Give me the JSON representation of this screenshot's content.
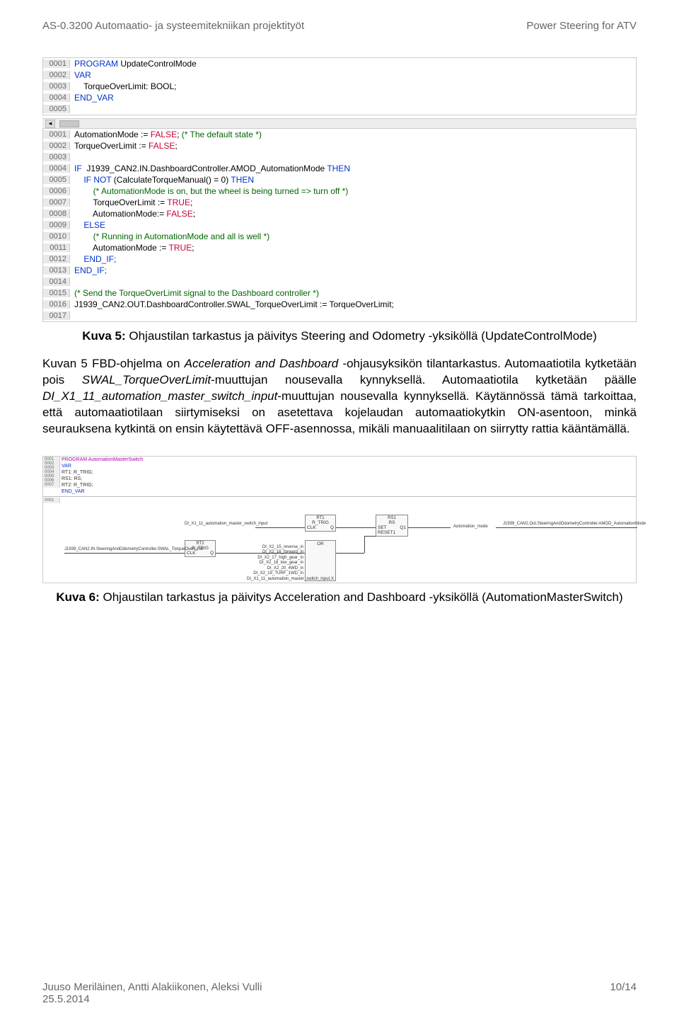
{
  "header": {
    "left": "AS-0.3200 Automaatio- ja systeemitekniikan projektityöt",
    "right": "Power Steering for ATV"
  },
  "code1": {
    "lines": [
      {
        "num": "0001",
        "pre": "",
        "tokens": [
          {
            "t": "PROGRAM ",
            "c": "blue"
          },
          {
            "t": "UpdateControlMode",
            "c": ""
          }
        ]
      },
      {
        "num": "0002",
        "pre": "",
        "tokens": [
          {
            "t": "VAR",
            "c": "blue"
          }
        ]
      },
      {
        "num": "0003",
        "pre": "    ",
        "tokens": [
          {
            "t": "TorqueOverLimit: BOOL;",
            "c": ""
          }
        ]
      },
      {
        "num": "0004",
        "pre": "",
        "tokens": [
          {
            "t": "END_VAR",
            "c": "blue"
          }
        ]
      },
      {
        "num": "0005",
        "pre": "",
        "tokens": []
      }
    ]
  },
  "code2": {
    "lines": [
      {
        "num": "0001",
        "pre": "",
        "tokens": [
          {
            "t": "AutomationMode := ",
            "c": ""
          },
          {
            "t": "FALSE",
            "c": "red"
          },
          {
            "t": "; ",
            "c": ""
          },
          {
            "t": "(* The default state *)",
            "c": "cmnt"
          }
        ]
      },
      {
        "num": "0002",
        "pre": "",
        "tokens": [
          {
            "t": "TorqueOverLimit := ",
            "c": ""
          },
          {
            "t": "FALSE",
            "c": "red"
          },
          {
            "t": ";",
            "c": ""
          }
        ]
      },
      {
        "num": "0003",
        "pre": "",
        "tokens": []
      },
      {
        "num": "0004",
        "pre": "",
        "tokens": [
          {
            "t": "IF  ",
            "c": "blue"
          },
          {
            "t": "J1939_CAN2.IN.DashboardController.AMOD_AutomationMode ",
            "c": ""
          },
          {
            "t": "THEN",
            "c": "blue"
          }
        ]
      },
      {
        "num": "0005",
        "pre": "    ",
        "tokens": [
          {
            "t": "IF NOT ",
            "c": "blue"
          },
          {
            "t": "(CalculateTorqueManual() = 0) ",
            "c": ""
          },
          {
            "t": "THEN",
            "c": "blue"
          }
        ]
      },
      {
        "num": "0006",
        "pre": "        ",
        "tokens": [
          {
            "t": "(* AutomationMode is on, but the wheel is being turned => turn off *)",
            "c": "cmnt"
          }
        ]
      },
      {
        "num": "0007",
        "pre": "        ",
        "tokens": [
          {
            "t": "TorqueOverLimit := ",
            "c": ""
          },
          {
            "t": "TRUE",
            "c": "red"
          },
          {
            "t": ";",
            "c": ""
          }
        ]
      },
      {
        "num": "0008",
        "pre": "        ",
        "tokens": [
          {
            "t": "AutomationMode:= ",
            "c": ""
          },
          {
            "t": "FALSE",
            "c": "red"
          },
          {
            "t": ";",
            "c": ""
          }
        ]
      },
      {
        "num": "0009",
        "pre": "    ",
        "tokens": [
          {
            "t": "ELSE",
            "c": "blue"
          }
        ]
      },
      {
        "num": "0010",
        "pre": "        ",
        "tokens": [
          {
            "t": "(* Running in AutomationMode and all is well *)",
            "c": "cmnt"
          }
        ]
      },
      {
        "num": "0011",
        "pre": "        ",
        "tokens": [
          {
            "t": "AutomationMode := ",
            "c": ""
          },
          {
            "t": "TRUE",
            "c": "red"
          },
          {
            "t": ";",
            "c": ""
          }
        ]
      },
      {
        "num": "0012",
        "pre": "    ",
        "tokens": [
          {
            "t": "END_IF;",
            "c": "blue"
          }
        ]
      },
      {
        "num": "0013",
        "pre": "",
        "tokens": [
          {
            "t": "END_IF;",
            "c": "blue"
          }
        ]
      },
      {
        "num": "0014",
        "pre": "",
        "tokens": []
      },
      {
        "num": "0015",
        "pre": "",
        "tokens": [
          {
            "t": "(* Send the TorqueOverLimit signal to the Dashboard controller *)",
            "c": "cmnt"
          }
        ]
      },
      {
        "num": "0016",
        "pre": "",
        "tokens": [
          {
            "t": "J1939_CAN2.OUT.DashboardController.SWAL_TorqueOverLimit := TorqueOverLimit;",
            "c": ""
          }
        ]
      },
      {
        "num": "0017",
        "pre": "",
        "tokens": []
      }
    ]
  },
  "caption1": {
    "bold": "Kuva 5:",
    "rest": " Ohjaustilan tarkastus ja päivitys Steering and Odometry -yksiköllä (UpdateControlMode)"
  },
  "body": {
    "p1_a": "Kuvan 5 FBD-ohjelma on ",
    "p1_i1": "Acceleration and Dashboard",
    "p1_b": " -ohjausyksikön tilantarkastus. Automaatiotila kytketään pois ",
    "p1_i2": "SWAL_TorqueOverLimit",
    "p1_c": "-muuttujan nousevalla kynnyksellä. Automaatiotila kytketään päälle ",
    "p1_i3": "DI_X1_11_automation_master_switch_input",
    "p1_d": "-muuttujan nousevalla kynnyksellä. Käytännössä tämä tarkoittaa, että automaatiotilaan siirtymiseksi on asetettava kojelaudan automaatiokytkin ON-asentoon, minkä seurauksena kytkintä on ensin käytettävä OFF-asennossa, mikäli manuaalitilaan on siirrytty rattia kääntämällä."
  },
  "diagram": {
    "var_lines": [
      "PROGRAM AutomationMasterSwitch",
      "VAR",
      "    RT1: R_TRIG;",
      "    RS1: RS;",
      "    RT2: R_TRIG;",
      "END_VAR"
    ],
    "blocks": {
      "rt1": "R_TRIG",
      "rt2": "R_TRIG",
      "rs": "RS",
      "or": "OR",
      "rt1_name": "RT1",
      "rt2_name": "RT2",
      "rs_name": "RS1",
      "clk": "CLK",
      "q": "Q",
      "set": "SET",
      "reset": "RESET1",
      "q1": "Q1"
    },
    "labels": {
      "in_top": "DI_X1_11_automation_master_switch_input",
      "in_left": "J1939_CAN2.IN.SteeringAndOdometryController.SWAL_TorqueOverLimit",
      "or_list": [
        "DI_X2_15_reverse_in",
        "DI_X2_16_forward_in",
        "DI_X2_17_high_gear_in",
        "DI_X2_18_low_gear_in",
        "DI_X2_20_4WD_in",
        "DI_X2_19_TURF_1WD_in",
        "DI_X1_11_automation_master_switch_input.X"
      ],
      "out_mid": "Automation_mode",
      "out_right": "J1939_CAN2.Out.SteeringAndOdometryController.AMOD_AutomationMode"
    }
  },
  "caption2": {
    "bold": "Kuva 6:",
    "rest": " Ohjaustilan tarkastus ja päivitys Acceleration and Dashboard -yksiköllä (AutomationMasterSwitch)"
  },
  "footer": {
    "left_line1": "Juuso Meriläinen, Antti Alakiikonen, Aleksi Vulli",
    "left_line2": "25.5.2014",
    "right": "10/14"
  }
}
